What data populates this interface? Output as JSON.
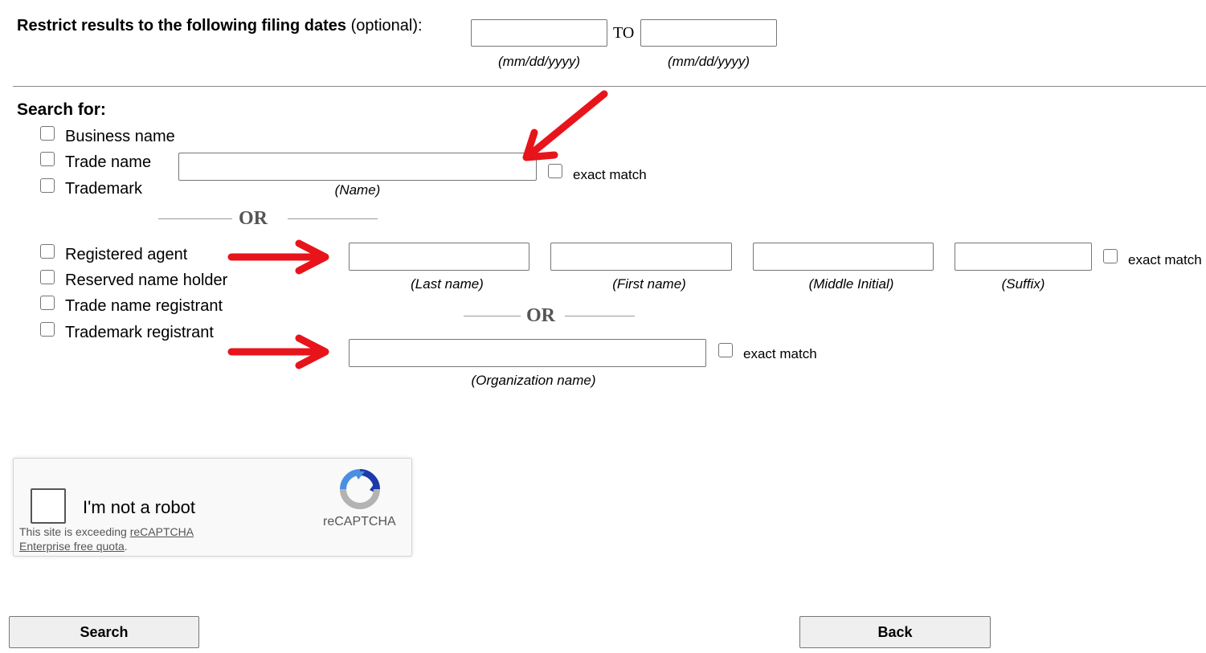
{
  "filing_dates": {
    "label_bold": "Restrict results to the following filing dates",
    "label_optional": "(optional):",
    "from_value": "",
    "to_value": "",
    "to_label": "TO",
    "from_hint": "(mm/dd/yyyy)",
    "to_hint": "(mm/dd/yyyy)"
  },
  "search_for": {
    "heading": "Search for:",
    "name_types": [
      {
        "label": "Business name",
        "checked": false
      },
      {
        "label": "Trade name",
        "checked": false
      },
      {
        "label": "Trademark",
        "checked": false
      }
    ],
    "name_value": "",
    "name_hint": "(Name)",
    "name_exact_label": "exact match",
    "or_label": "OR",
    "party_types": [
      {
        "label": "Registered agent",
        "checked": false
      },
      {
        "label": "Reserved name holder",
        "checked": false
      },
      {
        "label": "Trade name registrant",
        "checked": false
      },
      {
        "label": "Trademark registrant",
        "checked": false
      }
    ],
    "person": {
      "last_hint": "(Last name)",
      "first_hint": "(First name)",
      "middle_hint": "(Middle Initial)",
      "suffix_hint": "(Suffix)",
      "exact_label": "exact match"
    },
    "or_label_2": "OR",
    "organization": {
      "hint": "(Organization name)",
      "exact_label": "exact match"
    }
  },
  "recaptcha": {
    "checkbox_label": "I'm not a robot",
    "note_prefix": "This site is exceeding ",
    "note_link": "reCAPTCHA Enterprise free quota",
    "note_suffix": ".",
    "brand": "reCAPTCHA"
  },
  "buttons": {
    "search": "Search",
    "back": "Back"
  },
  "colors": {
    "annotation_arrow": "#e8141b",
    "recaptcha_blue": "#4a90e2",
    "recaptcha_dark_blue": "#1c3aa9",
    "recaptcha_grey": "#b3b3b3"
  }
}
